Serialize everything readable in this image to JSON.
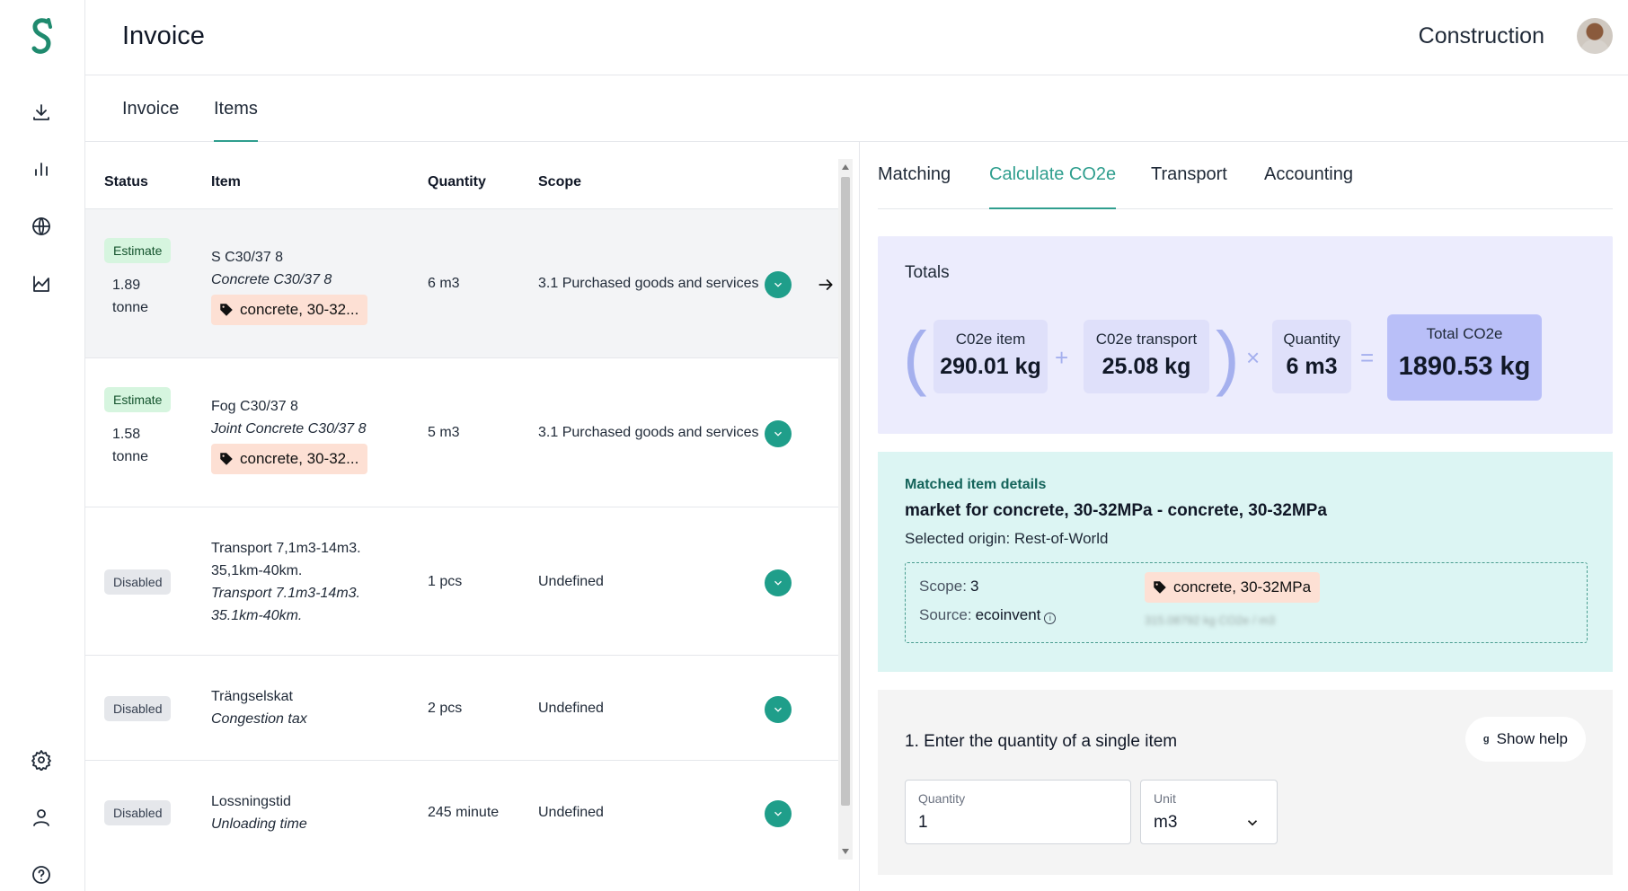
{
  "header": {
    "title": "Invoice",
    "org": "Construction"
  },
  "tabs": [
    {
      "label": "Invoice"
    },
    {
      "label": "Items"
    }
  ],
  "table": {
    "headers": {
      "status": "Status",
      "item": "Item",
      "quantity": "Quantity",
      "scope": "Scope"
    },
    "rows": [
      {
        "status": "Estimate",
        "est_value": "1.89",
        "est_unit": "tonne",
        "name": "S C30/37 8",
        "sub": "Concrete C30/37 8",
        "tag": "concrete, 30-32...",
        "quantity": "6 m3",
        "scope": "3.1 Purchased goods and services"
      },
      {
        "status": "Estimate",
        "est_value": "1.58",
        "est_unit": "tonne",
        "name": "Fog C30/37 8",
        "sub": "Joint Concrete C30/37 8",
        "tag": "concrete, 30-32...",
        "quantity": "5 m3",
        "scope": "3.1 Purchased goods and services"
      },
      {
        "status": "Disabled",
        "name": "Transport 7,1m3-14m3.",
        "name2": "35,1km-40km.",
        "sub": "Transport 7.1m3-14m3.",
        "sub2": "35.1km-40km.",
        "quantity": "1 pcs",
        "scope": "Undefined"
      },
      {
        "status": "Disabled",
        "name": "Trängselskat",
        "sub": "Congestion tax",
        "quantity": "2 pcs",
        "scope": "Undefined"
      },
      {
        "status": "Disabled",
        "name": "Lossningstid",
        "sub": "Unloading time",
        "quantity": "245 minute",
        "scope": "Undefined"
      }
    ]
  },
  "detail": {
    "tabs": [
      {
        "label": "Matching"
      },
      {
        "label": "Calculate CO2e"
      },
      {
        "label": "Transport"
      },
      {
        "label": "Accounting"
      }
    ],
    "totals": {
      "title": "Totals",
      "co2e_item_label": "C02e item",
      "co2e_item_value": "290.01 kg",
      "co2e_transport_label": "C02e transport",
      "co2e_transport_value": "25.08 kg",
      "quantity_label": "Quantity",
      "quantity_value": "6 m3",
      "total_label": "Total CO2e",
      "total_value": "1890.53 kg"
    },
    "matched": {
      "label": "Matched item details",
      "title": "market for concrete, 30-32MPa - concrete, 30-32MPa",
      "origin": "Selected origin: Rest-of-World",
      "scope_label": "Scope:",
      "scope_value": "3",
      "source_label": "Source:",
      "source_value": "ecoinvent",
      "tag": "concrete, 30-32MPa",
      "blurred_factor": "315.08792 kg CO2e / m3"
    },
    "quantity_card": {
      "title": "1. Enter the quantity of a single item",
      "help_label": "Show help",
      "quantity_label": "Quantity",
      "quantity_value": "1",
      "unit_label": "Unit",
      "unit_value": "m3"
    }
  },
  "colors": {
    "accent": "#2f9e8e",
    "estimate_bg": "#d6f5df",
    "tag_bg": "#fde0d4",
    "totals_bg": "#ececfd",
    "matched_bg": "#dcf5f3"
  },
  "icons": {
    "sidebar": [
      "download-icon",
      "bar-chart-icon",
      "globe-icon",
      "area-chart-icon",
      "gear-icon",
      "user-icon",
      "help-icon"
    ]
  }
}
